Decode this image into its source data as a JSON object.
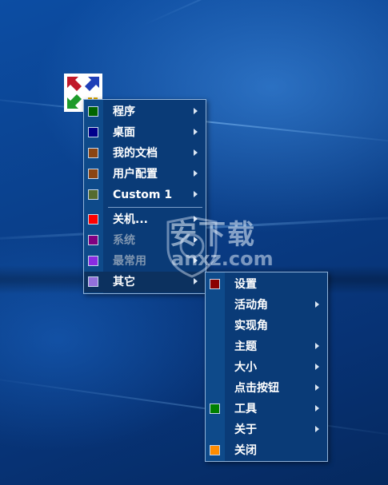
{
  "main_menu": {
    "items": [
      {
        "label": "程序",
        "swatch": "#006400",
        "submenu": true,
        "disabled": false
      },
      {
        "label": "桌面",
        "swatch": "#00008b",
        "submenu": true,
        "disabled": false
      },
      {
        "label": "我的文档",
        "swatch": "#8b4513",
        "submenu": true,
        "disabled": false
      },
      {
        "label": "用户配置",
        "swatch": "#8b4513",
        "submenu": true,
        "disabled": false
      },
      {
        "label": "Custom 1",
        "swatch": "#556b2f",
        "submenu": true,
        "disabled": false
      },
      {
        "label": "关机...",
        "swatch": "#ff0000",
        "submenu": true,
        "disabled": false
      },
      {
        "label": "系统",
        "swatch": "#800080",
        "submenu": true,
        "disabled": true
      },
      {
        "label": "最常用",
        "swatch": "#8a2be2",
        "submenu": true,
        "disabled": true
      },
      {
        "label": "其它",
        "swatch": "#9370db",
        "submenu": true,
        "disabled": false
      }
    ]
  },
  "sub_menu": {
    "items": [
      {
        "label": "设置",
        "swatch": "#8b0000",
        "submenu": false
      },
      {
        "label": "活动角",
        "swatch": "",
        "submenu": true
      },
      {
        "label": "实现角",
        "swatch": "",
        "submenu": false
      },
      {
        "label": "主题",
        "swatch": "",
        "submenu": true
      },
      {
        "label": "大小",
        "swatch": "",
        "submenu": true
      },
      {
        "label": "点击按钮",
        "swatch": "",
        "submenu": true
      },
      {
        "label": "工具",
        "swatch": "#008000",
        "submenu": true
      },
      {
        "label": "关于",
        "swatch": "",
        "submenu": true
      },
      {
        "label": "关闭",
        "swatch": "#ff8c00",
        "submenu": false
      }
    ]
  },
  "watermark": {
    "text": "安下载",
    "domain": "anxz.com"
  },
  "icons": {
    "app_icon": "arrows-corners-icon",
    "submenu_arrow": "chevron-right-icon"
  }
}
